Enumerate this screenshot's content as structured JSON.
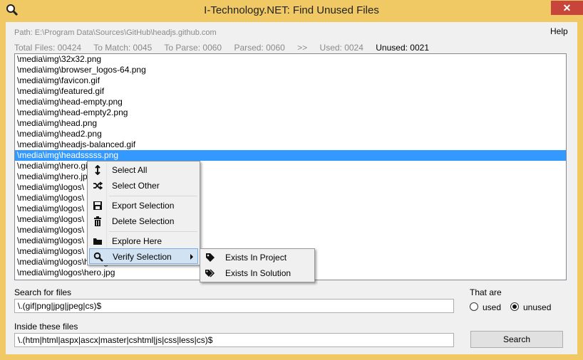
{
  "window": {
    "title": "I-Technology.NET: Find Unused Files",
    "close_glyph": "✕"
  },
  "header": {
    "path": "Path: E:\\Program Data\\Sources\\GitHub\\headjs.github.com",
    "help": "Help"
  },
  "stats": {
    "total": "Total Files: 00424",
    "to_match": "To Match: 0045",
    "to_parse": "To Parse: 0060",
    "parsed": "Parsed: 0060",
    "arrow": ">>",
    "used": "Used: 0024",
    "unused": "Unused: 0021"
  },
  "file_list": {
    "selected_index": 9,
    "items": [
      "\\media\\img\\32x32.png",
      "\\media\\img\\browser_logos-64.png",
      "\\media\\img\\favicon.gif",
      "\\media\\img\\featured.gif",
      "\\media\\img\\head-empty.png",
      "\\media\\img\\head-empty2.png",
      "\\media\\img\\head.png",
      "\\media\\img\\head2.png",
      "\\media\\img\\headjs-balanced.gif",
      "\\media\\img\\headsssss.png",
      "\\media\\img\\hero.gif",
      "\\media\\img\\hero.jpg",
      "\\media\\img\\logos\\",
      "\\media\\img\\logos\\",
      "\\media\\img\\logos\\",
      "\\media\\img\\logos\\",
      "\\media\\img\\logos\\",
      "\\media\\img\\logos\\",
      "\\media\\img\\logos\\",
      "\\media\\img\\logos\\hero.gif",
      "\\media\\img\\logos\\hero.jpg"
    ]
  },
  "context_menu": {
    "items": [
      {
        "label": "Select All",
        "icon": "arrows-vertical-icon"
      },
      {
        "label": "Select Other",
        "icon": "shuffle-icon"
      },
      {
        "label": "Export Selection",
        "icon": "save-icon"
      },
      {
        "label": "Delete Selection",
        "icon": "trash-icon"
      },
      {
        "label": "Explore Here",
        "icon": "folder-icon"
      },
      {
        "label": "Verify Selection",
        "icon": "search-icon"
      }
    ]
  },
  "submenu": {
    "items": [
      {
        "label": "Exists In Project",
        "icon": "tag-icon"
      },
      {
        "label": "Exists In Solution",
        "icon": "tags-icon"
      }
    ]
  },
  "search": {
    "label": "Search for files",
    "value": "\\.(gif|png|jpg|jpeg|cs)$"
  },
  "inside": {
    "label": "Inside these files",
    "value": "\\.(htm|html|aspx|ascx|master|cshtml|js|css|less|cs)$"
  },
  "that_are": {
    "label": "That are",
    "used": "used",
    "unused": "unused",
    "selected": "unused"
  },
  "search_button": "Search",
  "colors": {
    "title_bar": "#f0c965",
    "selection": "#3399ff",
    "close": "#c7453b"
  }
}
